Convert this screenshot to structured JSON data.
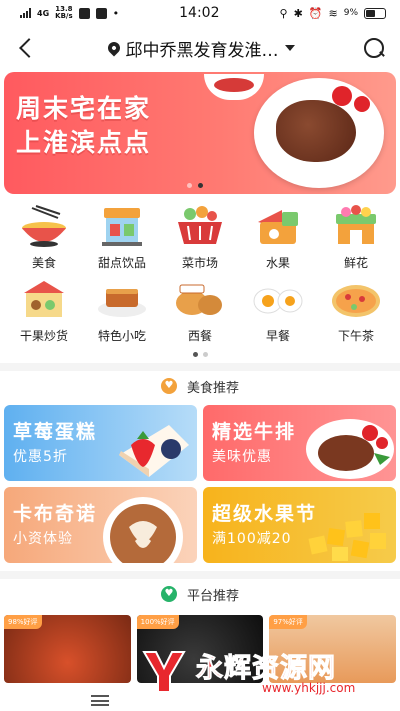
{
  "status_bar": {
    "signal": "4G",
    "speed_value": "13.8",
    "speed_unit": "KB/s",
    "time": "14:02",
    "battery": "9%"
  },
  "header": {
    "location": "邱中乔黑发育发淮…",
    "icons": [
      "back-arrow-icon",
      "location-pin-icon",
      "chevron-down-icon",
      "search-icon"
    ]
  },
  "banner": {
    "line1": "周末宅在家",
    "line2": "上淮滨点点",
    "slide_count": 2,
    "active_slide": 2
  },
  "categories": {
    "row1": [
      {
        "label": "美食",
        "icon": "noodle-bowl-icon"
      },
      {
        "label": "甜点饮品",
        "icon": "dessert-shop-icon"
      },
      {
        "label": "菜市场",
        "icon": "basket-icon"
      },
      {
        "label": "水果",
        "icon": "fruit-icon"
      },
      {
        "label": "鲜花",
        "icon": "flower-icon"
      }
    ],
    "row2": [
      {
        "label": "干果炒货",
        "icon": "nut-shop-icon"
      },
      {
        "label": "特色小吃",
        "icon": "snack-plate-icon"
      },
      {
        "label": "西餐",
        "icon": "bread-icon"
      },
      {
        "label": "早餐",
        "icon": "egg-icon"
      },
      {
        "label": "下午茶",
        "icon": "pizza-icon"
      }
    ],
    "page_count": 2,
    "active_page": 1
  },
  "food_section": {
    "title": "美食推荐",
    "promos": [
      {
        "title": "草莓蛋糕",
        "subtitle": "优惠5折"
      },
      {
        "title": "精选牛排",
        "subtitle": "美味优惠"
      },
      {
        "title": "卡布奇诺",
        "subtitle": "小资体验"
      },
      {
        "title": "超级水果节",
        "subtitle": "满100减20"
      }
    ]
  },
  "platform_section": {
    "title": "平台推荐",
    "cards": [
      {
        "badge": "98%好评"
      },
      {
        "badge": "100%好评"
      },
      {
        "badge": "97%好评"
      }
    ]
  },
  "watermark": {
    "name": "永辉资源网",
    "url": "www.yhkjjj.com"
  },
  "colors": {
    "banner": "#ff5a5f",
    "strawberry_card": "#5fb0f0",
    "steak_card": "#ff6a6a",
    "coffee_card": "#f6a87a",
    "fruit_card": "#f7b31c",
    "watermark": "#e8282e"
  }
}
